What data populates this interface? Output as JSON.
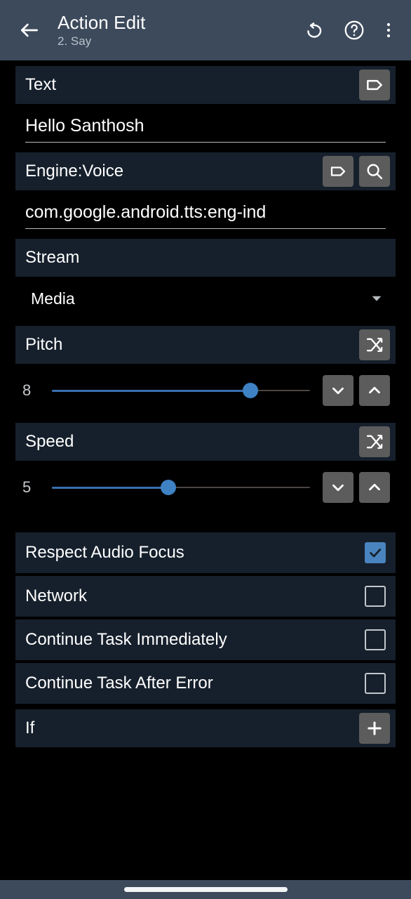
{
  "header": {
    "back_icon": "arrow-left-icon",
    "title": "Action Edit",
    "subtitle": "2. Say",
    "actions": [
      {
        "name": "revert-button",
        "icon": "undo-icon"
      },
      {
        "name": "help-button",
        "icon": "help-circle-icon"
      },
      {
        "name": "overflow-menu-button",
        "icon": "more-vertical-icon"
      }
    ]
  },
  "sections": {
    "text": {
      "label": "Text",
      "tag_icon": "tag-icon",
      "value": "Hello Santhosh"
    },
    "engine_voice": {
      "label": "Engine:Voice",
      "tag_icon": "tag-icon",
      "search_icon": "search-icon",
      "value": "com.google.android.tts:eng-ind"
    },
    "stream": {
      "label": "Stream",
      "value": "Media",
      "chevron_icon": "chevron-down-icon"
    },
    "pitch": {
      "label": "Pitch",
      "shuffle_icon": "shuffle-icon",
      "value": "8",
      "fill_percent": 77,
      "decrement_icon": "chevron-down-icon",
      "increment_icon": "chevron-up-icon"
    },
    "speed": {
      "label": "Speed",
      "shuffle_icon": "shuffle-icon",
      "value": "5",
      "fill_percent": 45,
      "decrement_icon": "chevron-down-icon",
      "increment_icon": "chevron-up-icon"
    }
  },
  "checkboxes": [
    {
      "label": "Respect Audio Focus",
      "checked": true
    },
    {
      "label": "Network",
      "checked": false
    },
    {
      "label": "Continue Task Immediately",
      "checked": false
    },
    {
      "label": "Continue Task After Error",
      "checked": false
    }
  ],
  "if_section": {
    "label": "If",
    "add_icon": "plus-icon"
  },
  "colors": {
    "page_background": "#000000",
    "appbar": "#3d4a5c",
    "section_header": "#16202c",
    "accent_blue": "#3e82c4",
    "button_gray": "#5c5c5c",
    "checkbox_checked": "#4a84bf"
  },
  "navbar": {
    "handle": "gesture-home-handle"
  }
}
